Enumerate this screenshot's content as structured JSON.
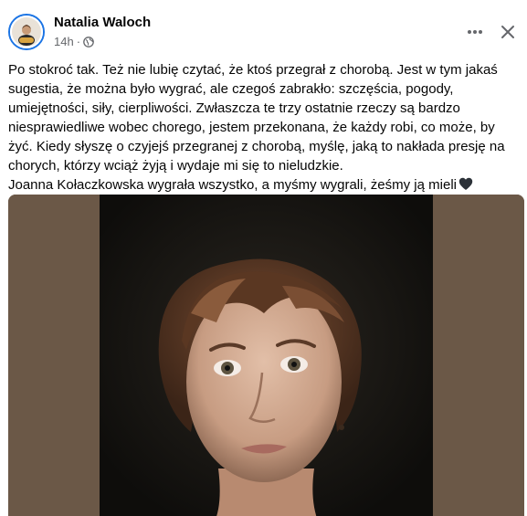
{
  "post": {
    "author": "Natalia Waloch",
    "time": "14h",
    "separator": "·",
    "text_lines": [
      "Po stokroć tak. Też nie lubię czytać, że ktoś przegrał z chorobą. Jest w tym jakaś",
      "sugestia, że można było wygrać, ale czegoś zabrakło: szczęścia, pogody,",
      "umiejętności, siły, cierpliwości. Zwłaszcza te trzy ostatnie rzeczy są bardzo",
      "niesprawiedliwe wobec chorego, jestem przekonana, że każdy robi, co może, by",
      "żyć. Kiedy słyszę o czyjejś przegranej z chorobą, myślę, jaką to nakłada presję na",
      "chorych, którzy wciąż żyją i wydaje mi się to nieludzkie.",
      "Joanna Kołaczkowska wygrała wszystko, a myśmy wygrali, żeśmy ją mieli"
    ],
    "audience_icon": "globe-icon",
    "emoji_icon": "black-heart-icon",
    "photo_description_icon": "portrait-photo"
  },
  "colors": {
    "text": "#050505",
    "secondary_text": "#65676b",
    "avatar_ring": "#1b74e4",
    "photo_background": "#6b5847"
  }
}
